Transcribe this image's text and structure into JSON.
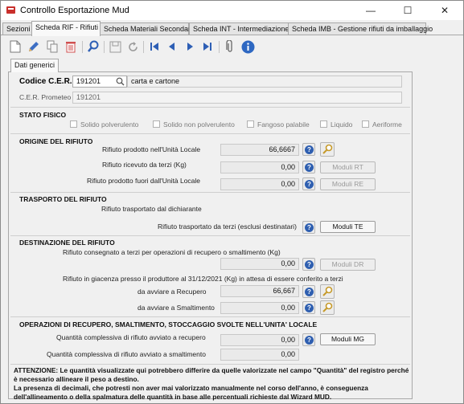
{
  "window": {
    "title": "Controllo Esportazione Mud",
    "minimize": "—",
    "maximize": "☐",
    "close": "✕"
  },
  "tabs": [
    {
      "label": "Sezioni"
    },
    {
      "label": "Scheda RIF - Rifiuti"
    },
    {
      "label": "Scheda Materiali Secondari"
    },
    {
      "label": "Scheda INT - Intermediazione"
    },
    {
      "label": "Scheda IMB - Gestione rifiuti da imballaggio"
    }
  ],
  "toolbar": {
    "icons": [
      "new-document-icon",
      "edit-icon",
      "copy-icon",
      "delete-icon",
      "search-icon",
      "save-icon",
      "refresh-icon",
      "first-record-icon",
      "previous-record-icon",
      "next-record-icon",
      "last-record-icon",
      "attachment-icon",
      "info-icon"
    ]
  },
  "subtab": {
    "label": "Dati generici"
  },
  "cer": {
    "label": "Codice C.E.R.",
    "code": "191201",
    "description": "carta e cartone",
    "prometeo_label": "C.E.R. Prometeo",
    "prometeo_value": "191201"
  },
  "stato_fisico": {
    "title": "STATO FISICO",
    "options": [
      "Solido polverulento",
      "Solido non polverulento",
      "Fangoso palabile",
      "Liquido",
      "Aeriforme"
    ]
  },
  "origine": {
    "title": "ORIGINE DEL RIFIUTO",
    "row1_label": "Rifiuto prodotto nell'Unità Locale",
    "row1_value": "66,6667",
    "row2_label": "Rifiuto ricevuto da terzi (Kg)",
    "row2_value": "0,00",
    "row2_button": "Moduli RT",
    "row3_label": "Rifiuto prodotto fuori dall'Unità Locale",
    "row3_value": "0,00",
    "row3_button": "Moduli RE"
  },
  "trasporto": {
    "title": "TRASPORTO DEL RIFIUTO",
    "row1_label": "Rifiuto trasportato dal dichiarante",
    "row2_label": "Rifiuto trasportato da terzi (esclusi destinatari)",
    "row2_button": "Moduli TE"
  },
  "destinazione": {
    "title": "DESTINAZIONE DEL RIFIUTO",
    "row1_label": "Rifiuto consegnato a terzi per operazioni di recupero o smaltimento (Kg)",
    "row1_value": "0,00",
    "row1_button": "Moduli DR",
    "row2_label": "Rifiuto in giacenza presso il produttore al 31/12/2021 (Kg) in attesa di essere conferito a terzi",
    "recupero_label": "da avviare a Recupero",
    "recupero_value": "66,667",
    "smaltimento_label": "da avviare a Smaltimento",
    "smaltimento_value": "0,00"
  },
  "operazioni": {
    "title": "OPERAZIONI DI RECUPERO, SMALTIMENTO, STOCCAGGIO SVOLTE NELL'UNITA' LOCALE",
    "row1_label": "Quantità complessiva di rifiuto avviato a recupero",
    "row1_value": "0,00",
    "row1_button": "Moduli MG",
    "row2_label": "Quantità complessiva di rifiuto avviato a smaltimento",
    "row2_value": "0,00"
  },
  "warning": {
    "text": "ATTENZIONE: Le quantità visualizzate qui potrebbero differire da quelle valorizzate nel campo \"Quantità\" del registro perché è necessario allineare il peso a destino.\nLa presenza di decimali, che potresti non aver mai valorizzato manualmente nel corso dell'anno, è conseguenza dell'allineamento o della spalmatura delle quantità in base alle percentuali richieste dal Wizard MUD."
  },
  "colors": {
    "help_icon": "#2f5fb0",
    "app_icon": "#c9302c"
  }
}
